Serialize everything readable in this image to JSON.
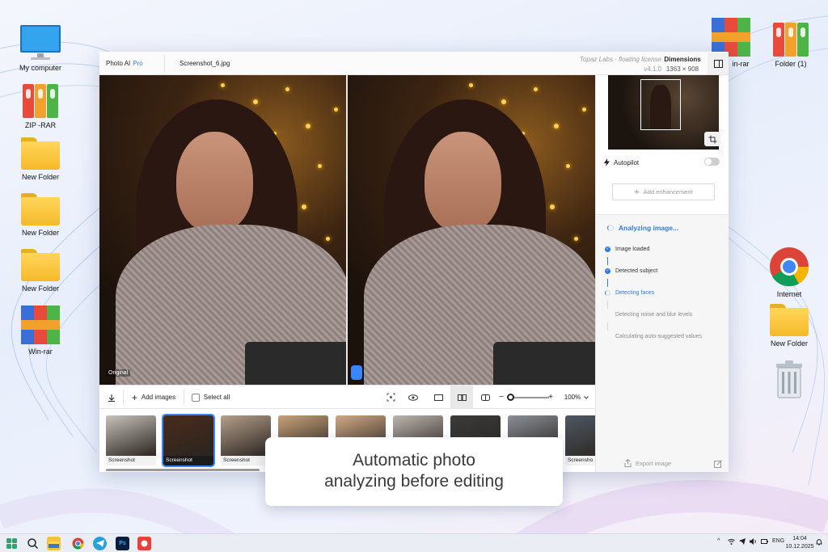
{
  "desktop": {
    "icons_left": [
      {
        "label": "My computer",
        "icon": "monitor-icon"
      },
      {
        "label": "ZIP -RAR",
        "icon": "archive-icon"
      },
      {
        "label": "New Folder",
        "icon": "folder-icon"
      },
      {
        "label": "New Folder",
        "icon": "folder-icon"
      },
      {
        "label": "New Folder",
        "icon": "folder-icon"
      },
      {
        "label": "Win-rar",
        "icon": "winrar-icon"
      }
    ],
    "icons_right": [
      {
        "label": "in-rar",
        "icon": "winrar-icon"
      },
      {
        "label": "Folder (1)",
        "icon": "archive-icon"
      },
      {
        "label": "Internet",
        "icon": "chrome-icon"
      },
      {
        "label": "New Folder",
        "icon": "folder-icon"
      },
      {
        "label": "",
        "icon": "recycle-bin-icon"
      }
    ]
  },
  "app": {
    "brand": "Photo AI",
    "brand_badge": "Pro",
    "file_name": "Screenshot_6.jpg",
    "license": "Topaz Labs - floating license",
    "version": "v4.1.0",
    "dimensions_label": "Dimensions",
    "dimensions_value": "1363 × 908",
    "viewer": {
      "original_label": "Original"
    },
    "toolbar": {
      "add_images": "Add images",
      "select_all": "Select all",
      "zoom": "100%",
      "zoom_minus": "−",
      "zoom_plus": "+"
    },
    "thumbnails": [
      {
        "caption": "Screenshot",
        "selected": false,
        "color": "#c7c2bb"
      },
      {
        "caption": "Screenshot",
        "selected": true,
        "color": "#4a2b1c"
      },
      {
        "caption": "Screenshot",
        "selected": false,
        "color": "#b59f8a"
      },
      {
        "caption": "",
        "selected": false,
        "color": "#c9a27a"
      },
      {
        "caption": "",
        "selected": false,
        "color": "#d1a985"
      },
      {
        "caption": "",
        "selected": false,
        "color": "#bdb5ae"
      },
      {
        "caption": "",
        "selected": false,
        "color": "#3b3b3b"
      },
      {
        "caption": "",
        "selected": false,
        "color": "#8a8f96"
      },
      {
        "caption": "Screensho",
        "selected": false,
        "color": "#4f5862"
      }
    ],
    "sidebar": {
      "autopilot": "Autopilot",
      "add_enhancement": "Add enhancement",
      "analyzing_title": "Analyzing image...",
      "steps": [
        {
          "label": "Image loaded",
          "state": "done"
        },
        {
          "label": "Detected subject",
          "state": "done"
        },
        {
          "label": "Detecting faces",
          "state": "active"
        },
        {
          "label": "Detecting noise and blur levels",
          "state": "pending"
        },
        {
          "label": "Calculating auto-suggested values",
          "state": "pending"
        }
      ],
      "export": "Export image"
    }
  },
  "caption": {
    "line1": "Automatic photo",
    "line2": "analyzing before editing"
  },
  "taskbar": {
    "lang": "ENG",
    "time": "14:04",
    "date": "10.12.2025"
  },
  "colors": {
    "accent": "#2f7be0",
    "handle": "#3a86ff"
  }
}
